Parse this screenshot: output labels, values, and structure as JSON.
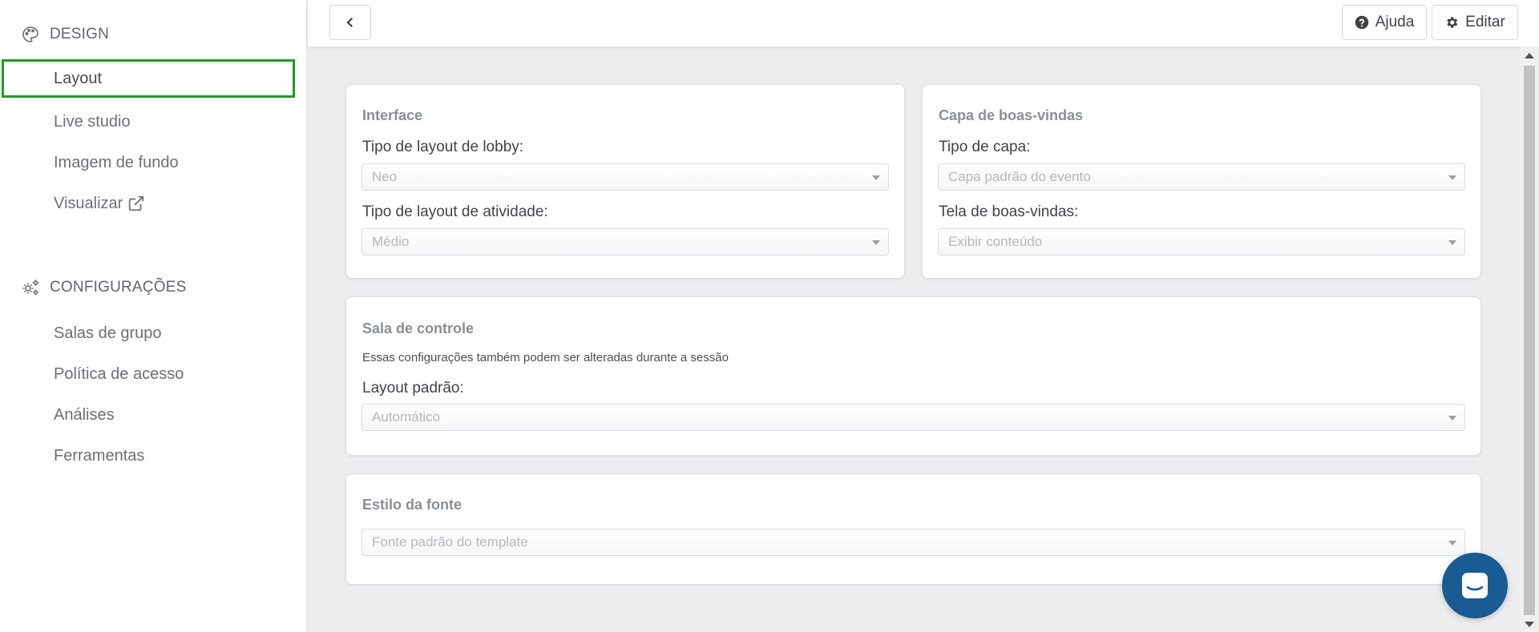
{
  "sidebar": {
    "design_heading": "DESIGN",
    "config_heading": "CONFIGURAÇÕES",
    "design_items": [
      {
        "label": "Layout"
      },
      {
        "label": "Live studio"
      },
      {
        "label": "Imagem de fundo"
      },
      {
        "label": "Visualizar"
      }
    ],
    "config_items": [
      {
        "label": "Salas de grupo"
      },
      {
        "label": "Política de acesso"
      },
      {
        "label": "Análises"
      },
      {
        "label": "Ferramentas"
      }
    ]
  },
  "topbar": {
    "help_label": "Ajuda",
    "edit_label": "Editar"
  },
  "interface_card": {
    "title": "Interface",
    "lobby_label": "Tipo de layout de lobby:",
    "lobby_value": "Neo",
    "activity_label": "Tipo de layout de atividade:",
    "activity_value": "Médio"
  },
  "welcome_card": {
    "title": "Capa de boas-vindas",
    "cover_label": "Tipo de capa:",
    "cover_value": "Capa padrão do evento",
    "screen_label": "Tela de boas-vindas:",
    "screen_value": "Exibir conteúdo"
  },
  "control_card": {
    "title": "Sala de controle",
    "subtitle": "Essas configurações também podem ser alteradas durante a sessão",
    "layout_label": "Layout padrão:",
    "layout_value": "Automático"
  },
  "font_card": {
    "title": "Estilo da fonte",
    "font_value": "Fonte padrão do template"
  },
  "colors": {
    "active_border": "#1f9c1f",
    "chat_bg": "#195b93"
  }
}
